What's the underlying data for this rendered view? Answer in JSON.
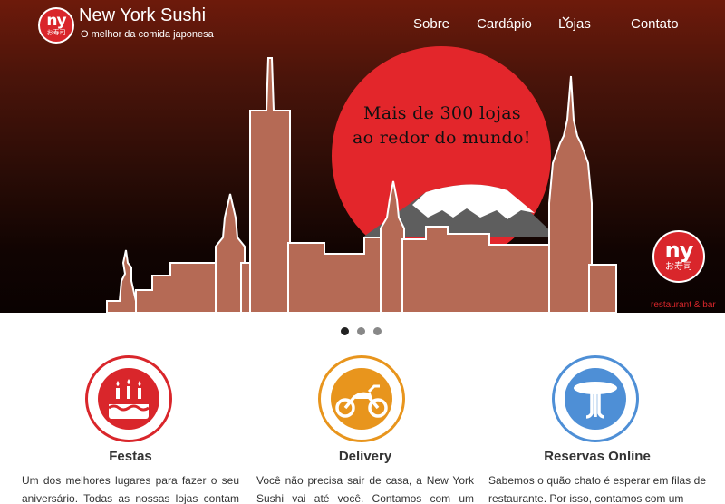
{
  "brand": {
    "logo_letters": "ny",
    "logo_japanese": "お寿司",
    "name": "New York Sushi",
    "tagline": "O melhor da comida japonesa"
  },
  "nav": {
    "items": [
      {
        "label": "Sobre"
      },
      {
        "label": "Cardápio"
      },
      {
        "label": "Lojas"
      },
      {
        "label": "Contato"
      }
    ]
  },
  "hero": {
    "line1": "Mais de 300 lojas",
    "line2": "ao redor do mundo!",
    "badge_letters": "ny",
    "badge_japanese": "お寿司",
    "badge_subtitle": "restaurant & bar"
  },
  "carousel": {
    "slide_count": 3,
    "active_index": 0
  },
  "features": [
    {
      "icon": "birthday-cake-icon",
      "title": "Festas",
      "text": "Um dos melhores lugares para fazer o seu aniversário. Todas as nossas lojas contam com"
    },
    {
      "icon": "motorcycle-icon",
      "title": "Delivery",
      "text": "Você não precisa sair de casa, a New York Sushi vai até você. Contamos com um serviço"
    },
    {
      "icon": "table-icon",
      "title": "Reservas Online",
      "text": "Sabemos o quão chato é esperar em filas de restaurante. Por isso, contamos com um"
    }
  ],
  "colors": {
    "brand_red": "#d9262b",
    "delivery_orange": "#e8951d",
    "reservation_blue": "#4e8fd6",
    "building": "#b56a55"
  }
}
